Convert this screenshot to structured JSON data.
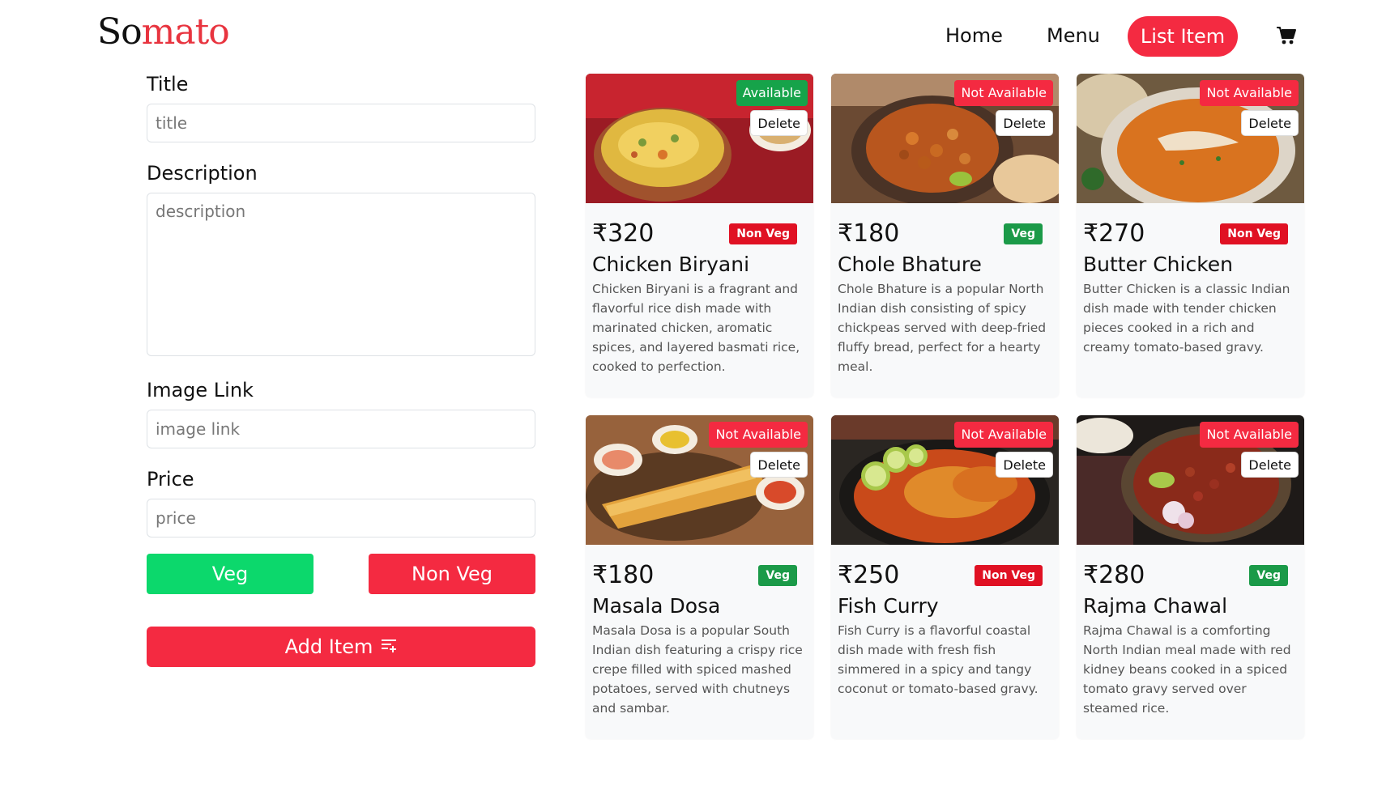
{
  "brand": {
    "logo_main": "So",
    "logo_accent": "mato"
  },
  "nav": {
    "home": "Home",
    "menu": "Menu",
    "list_item": "List Item",
    "cart_icon": "cart-icon"
  },
  "form": {
    "title_label": "Title",
    "title_placeholder": "title",
    "description_label": "Description",
    "description_placeholder": "description",
    "image_label": "Image Link",
    "image_placeholder": "image link",
    "price_label": "Price",
    "price_placeholder": "price",
    "veg_button": "Veg",
    "nonveg_button": "Non Veg",
    "add_button": "Add Item",
    "add_icon": "list-add-icon"
  },
  "colors": {
    "primary": "#f42a41",
    "veg_green": "#0cd86c",
    "badge_green": "#1b9a48",
    "available_green": "#16a34a"
  },
  "items": [
    {
      "price": "₹320",
      "name": "Chicken Biryani",
      "type": "Non Veg",
      "availability": "Available",
      "delete": "Delete",
      "description": "Chicken Biryani is a fragrant and flavorful rice dish made with marinated chicken, aromatic spices, and layered basmati rice, cooked to perfection."
    },
    {
      "price": "₹180",
      "name": "Chole Bhature",
      "type": "Veg",
      "availability": "Not Available",
      "delete": "Delete",
      "description": "Chole Bhature is a popular North Indian dish consisting of spicy chickpeas served with deep-fried fluffy bread, perfect for a hearty meal."
    },
    {
      "price": "₹270",
      "name": "Butter Chicken",
      "type": "Non Veg",
      "availability": "Not Available",
      "delete": "Delete",
      "description": "Butter Chicken is a classic Indian dish made with tender chicken pieces cooked in a rich and creamy tomato-based gravy."
    },
    {
      "price": "₹180",
      "name": "Masala Dosa",
      "type": "Veg",
      "availability": "Not Available",
      "delete": "Delete",
      "description": "Masala Dosa is a popular South Indian dish featuring a crispy rice crepe filled with spiced mashed potatoes, served with chutneys and sambar."
    },
    {
      "price": "₹250",
      "name": "Fish Curry",
      "type": "Non Veg",
      "availability": "Not Available",
      "delete": "Delete",
      "description": "Fish Curry is a flavorful coastal dish made with fresh fish simmered in a spicy and tangy coconut or tomato-based gravy."
    },
    {
      "price": "₹280",
      "name": "Rajma Chawal",
      "type": "Veg",
      "availability": "Not Available",
      "delete": "Delete",
      "description": "Rajma Chawal is a comforting North Indian meal made with red kidney beans cooked in a spiced tomato gravy served over steamed rice."
    }
  ]
}
